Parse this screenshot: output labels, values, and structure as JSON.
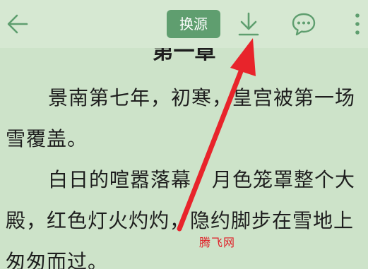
{
  "toolbar": {
    "source_label": "换源",
    "back_icon": "arrow-left-icon",
    "download_icon": "download-icon",
    "comment_icon": "comment-icon",
    "more_icon": "more-vertical-icon",
    "icon_color": "#5f9e6f",
    "button_color": "#5f9e6f"
  },
  "content": {
    "chapter_title": "第一章",
    "paragraphs": [
      "景南第七年，初寒，皇宫被第一场雪覆盖。",
      "白日的喧嚣落幕，月色笼罩整个大殿，红色灯火灼灼，隐约脚步在雪地上匆匆而过。"
    ]
  },
  "annotation": {
    "watermark": "腾飞网",
    "arrow_color": "#e8242b"
  },
  "theme": {
    "background": "#cde3c9",
    "text_color": "#1e1e1e"
  }
}
